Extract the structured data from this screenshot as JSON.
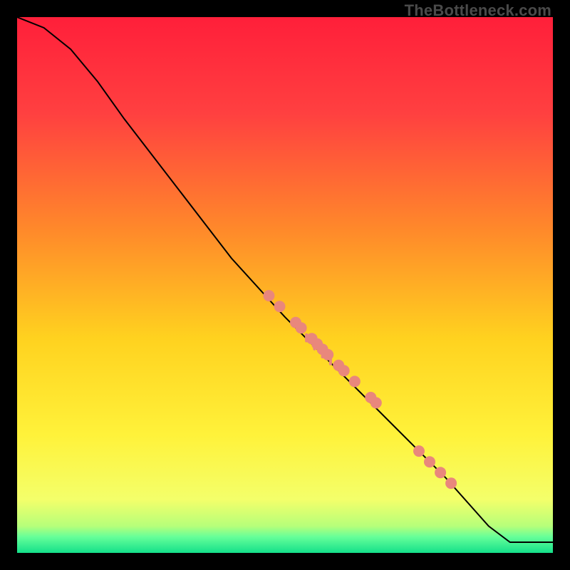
{
  "watermark": "TheBottleneck.com",
  "chart_data": {
    "type": "line",
    "title": "",
    "xlabel": "",
    "ylabel": "",
    "xlim": [
      0,
      100
    ],
    "ylim": [
      0,
      100
    ],
    "gradient_stops": [
      {
        "offset": 0,
        "color": "#ff1f3a"
      },
      {
        "offset": 18,
        "color": "#ff4040"
      },
      {
        "offset": 40,
        "color": "#ff8a2a"
      },
      {
        "offset": 60,
        "color": "#ffd21f"
      },
      {
        "offset": 78,
        "color": "#fff23a"
      },
      {
        "offset": 90,
        "color": "#f4ff6a"
      },
      {
        "offset": 95,
        "color": "#b6ff7a"
      },
      {
        "offset": 97,
        "color": "#66ff99"
      },
      {
        "offset": 100,
        "color": "#14e08a"
      }
    ],
    "curve": [
      {
        "x": 0,
        "y": 100
      },
      {
        "x": 5,
        "y": 98
      },
      {
        "x": 10,
        "y": 94
      },
      {
        "x": 15,
        "y": 88
      },
      {
        "x": 20,
        "y": 81
      },
      {
        "x": 30,
        "y": 68
      },
      {
        "x": 40,
        "y": 55
      },
      {
        "x": 50,
        "y": 44
      },
      {
        "x": 60,
        "y": 34
      },
      {
        "x": 70,
        "y": 24
      },
      {
        "x": 80,
        "y": 14
      },
      {
        "x": 88,
        "y": 5
      },
      {
        "x": 92,
        "y": 2
      },
      {
        "x": 100,
        "y": 2
      }
    ],
    "points": [
      {
        "x": 47,
        "y": 48
      },
      {
        "x": 49,
        "y": 46
      },
      {
        "x": 52,
        "y": 43
      },
      {
        "x": 53,
        "y": 42
      },
      {
        "x": 55,
        "y": 40
      },
      {
        "x": 56,
        "y": 39
      },
      {
        "x": 57,
        "y": 38
      },
      {
        "x": 58,
        "y": 37
      },
      {
        "x": 60,
        "y": 35
      },
      {
        "x": 61,
        "y": 34
      },
      {
        "x": 63,
        "y": 32
      },
      {
        "x": 66,
        "y": 29
      },
      {
        "x": 67,
        "y": 28
      },
      {
        "x": 75,
        "y": 19
      },
      {
        "x": 77,
        "y": 17
      },
      {
        "x": 79,
        "y": 15
      },
      {
        "x": 81,
        "y": 13
      }
    ],
    "drips": [
      {
        "x": 54,
        "y_top": 41,
        "y_bot": 39.3
      },
      {
        "x": 55.5,
        "y_top": 39.5,
        "y_bot": 37.8
      },
      {
        "x": 57,
        "y_top": 38,
        "y_bot": 36.3
      },
      {
        "x": 58.5,
        "y_top": 36.5,
        "y_bot": 35.0
      }
    ],
    "point_color": "#e9877c",
    "line_color": "#000000"
  }
}
